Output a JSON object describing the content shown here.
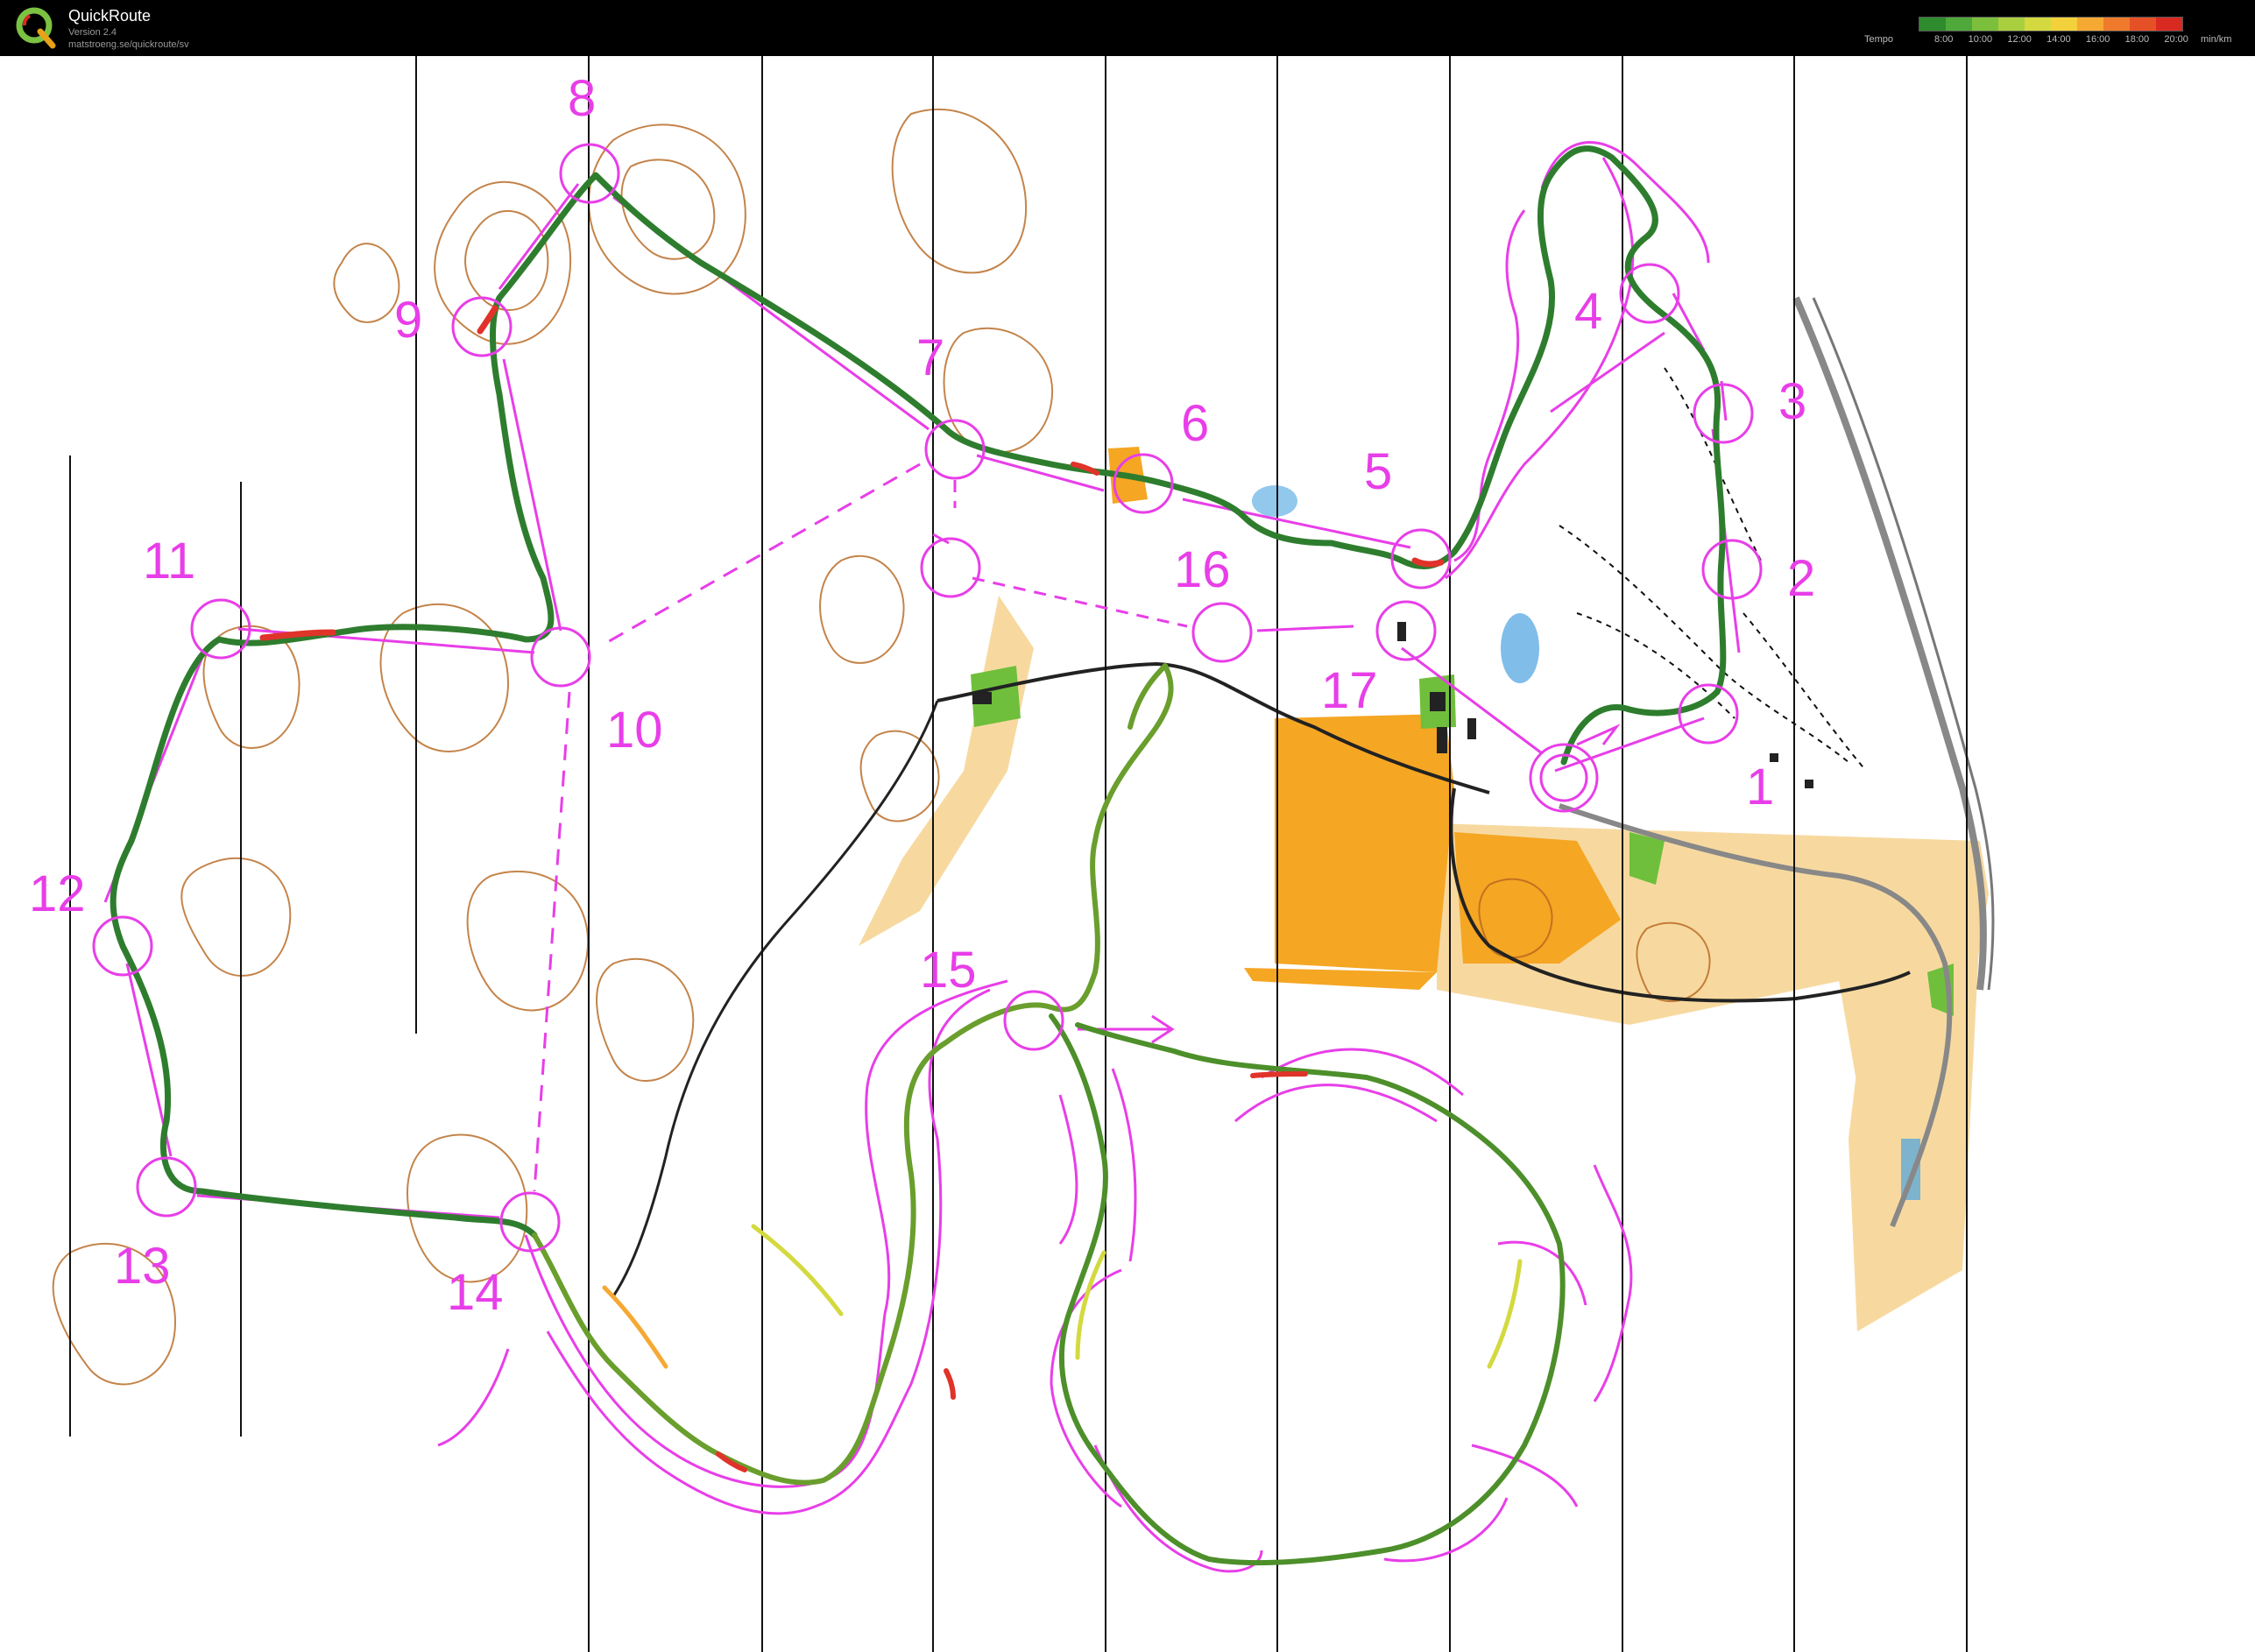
{
  "app": {
    "title": "QuickRoute",
    "version": "Version 2.4",
    "url": "matstroeng.se/quickroute/sv"
  },
  "tempo_legend": {
    "label": "Tempo",
    "ticks": [
      "8:00",
      "10:00",
      "12:00",
      "14:00",
      "16:00",
      "18:00",
      "20:00"
    ],
    "unit": "min/km",
    "gradient_colors": [
      "#2e8b2e",
      "#4ea83a",
      "#7cbf3c",
      "#a9cf3e",
      "#d4d93f",
      "#f2d13a",
      "#f5a933",
      "#ef7a2c",
      "#e65027",
      "#d92a22"
    ]
  },
  "colors": {
    "course_overprint": "#e83ee8",
    "route_fast": "#2e7d2e",
    "route_slow": "#e0332a",
    "contour": "#b5651d",
    "open_land": "#f5a623",
    "rough_open": "#f7d9a0",
    "vegetation_green": "#6fbf3c",
    "water": "#4aa3df"
  },
  "controls": [
    {
      "label": "1"
    },
    {
      "label": "2"
    },
    {
      "label": "3"
    },
    {
      "label": "4"
    },
    {
      "label": "5"
    },
    {
      "label": "6"
    },
    {
      "label": "7"
    },
    {
      "label": "8"
    },
    {
      "label": "9"
    },
    {
      "label": "10"
    },
    {
      "label": "11"
    },
    {
      "label": "12"
    },
    {
      "label": "13"
    },
    {
      "label": "14"
    },
    {
      "label": "15"
    },
    {
      "label": "16"
    },
    {
      "label": "17"
    }
  ]
}
